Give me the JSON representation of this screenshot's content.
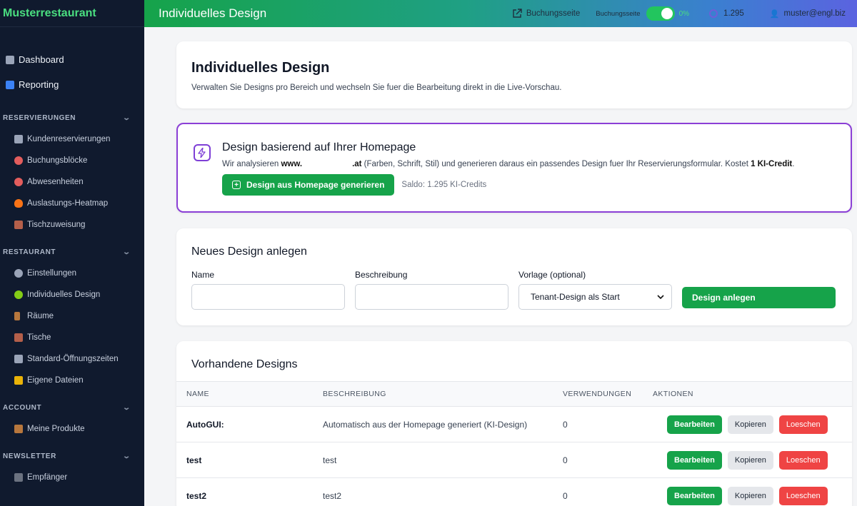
{
  "sidebar": {
    "brand": "Musterrestaurant",
    "top_items": [
      {
        "label": "Dashboard",
        "icon": "chart-icon",
        "color": "#9aa4b8"
      },
      {
        "label": "Reporting",
        "icon": "bar-chart-icon",
        "color": "#3b82f6"
      }
    ],
    "sections": {
      "reservierungen": {
        "title": "RESERVIERUNGEN",
        "items": [
          {
            "label": "Kundenreservierungen",
            "icon": "calendar-icon",
            "color": "#9aa4b8"
          },
          {
            "label": "Buchungsblöcke",
            "icon": "alarm-icon",
            "color": "#e35d5d"
          },
          {
            "label": "Abwesenheiten",
            "icon": "no-entry-icon",
            "color": "#e35d5d"
          },
          {
            "label": "Auslastungs-Heatmap",
            "icon": "fire-icon",
            "color": "#f97316"
          },
          {
            "label": "Tischzuweisung",
            "icon": "chair-icon",
            "color": "#b45f4a"
          }
        ]
      },
      "restaurant": {
        "title": "RESTAURANT",
        "items": [
          {
            "label": "Einstellungen",
            "icon": "gear-icon",
            "color": "#9aa4b8"
          },
          {
            "label": "Individuelles Design",
            "icon": "palette-icon",
            "color": "#84cc16"
          },
          {
            "label": "Räume",
            "icon": "door-icon",
            "color": "#b7773d"
          },
          {
            "label": "Tische",
            "icon": "chair-icon",
            "color": "#b45f4a"
          },
          {
            "label": "Standard-Öffnungszeiten",
            "icon": "calendar-icon",
            "color": "#9aa4b8"
          },
          {
            "label": "Eigene Dateien",
            "icon": "folder-icon",
            "color": "#eab308"
          }
        ]
      },
      "account": {
        "title": "ACCOUNT",
        "items": [
          {
            "label": "Meine Produkte",
            "icon": "package-icon",
            "color": "#b7773d"
          }
        ]
      },
      "newsletter": {
        "title": "NEWSLETTER",
        "items": [
          {
            "label": "Empfänger",
            "icon": "users-icon",
            "color": "#6b7280"
          }
        ]
      }
    }
  },
  "header": {
    "title": "Individuelles Design",
    "booking_link": "Buchungsseite",
    "booking_toggle_label": "Buchungsseite",
    "toggle_pct": "0%",
    "credits": "1.295",
    "user": "muster@engl.biz"
  },
  "intro": {
    "title": "Individuelles Design",
    "subtitle": "Verwalten Sie Designs pro Bereich und wechseln Sie fuer die Bearbeitung direkt in die Live-Vorschau."
  },
  "ai_card": {
    "title": "Design basierend auf Ihrer Homepage",
    "text_prefix": "Wir analysieren ",
    "domain_start": "www.",
    "domain_end": ".at",
    "text_middle": " (Farben, Schrift, Stil) und generieren daraus ein passendes Design fuer Ihr Reservierungsformular. Kostet ",
    "cost": "1 KI-Credit",
    "text_end": ".",
    "button": "Design aus Homepage generieren",
    "balance": "Saldo: 1.295 KI-Credits"
  },
  "new_design": {
    "title": "Neues Design anlegen",
    "name_label": "Name",
    "name_value": "",
    "desc_label": "Beschreibung",
    "desc_value": "",
    "template_label": "Vorlage (optional)",
    "template_value": "Tenant-Design als Start",
    "button": "Design anlegen"
  },
  "designs": {
    "title": "Vorhandene Designs",
    "columns": [
      "NAME",
      "BESCHREIBUNG",
      "VERWENDUNGEN",
      "AKTIONEN"
    ],
    "rows": [
      {
        "name": "AutoGUI:",
        "description": "Automatisch aus der Homepage generiert (KI-Design)",
        "uses": "0"
      },
      {
        "name": "test",
        "description": "test",
        "uses": "0"
      },
      {
        "name": "test2",
        "description": "test2",
        "uses": "0"
      }
    ],
    "actions": {
      "edit": "Bearbeiten",
      "copy": "Kopieren",
      "delete": "Loeschen"
    }
  }
}
